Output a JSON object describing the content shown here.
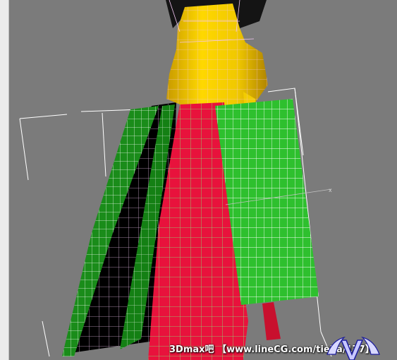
{
  "viewport": {
    "background": "#7b7b7b",
    "side_panel_color": "#ececec"
  },
  "model": {
    "bodice_color": "#f0d000",
    "skirt_red_color": "#e8123c",
    "skirt_green_color": "#1fa81f",
    "skirt_black_color": "#000000",
    "wire_pink": "#f0b8f0",
    "wire_green": "#70ff70",
    "gizmo_white": "#ffffff"
  },
  "watermark": {
    "text": "3Dmax吧 【www.lineCG.com/tieba/177】"
  },
  "icons": {
    "logo": "wing-logo-icon"
  }
}
